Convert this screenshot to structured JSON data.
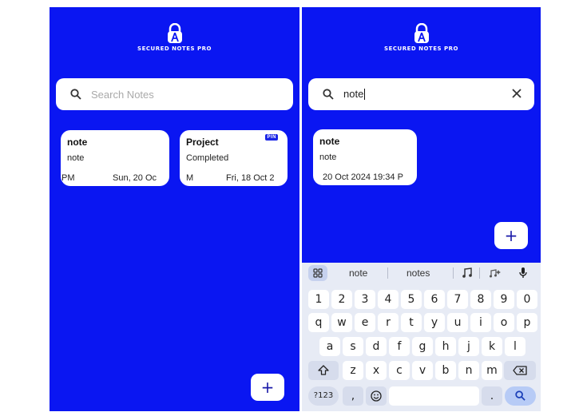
{
  "brand": {
    "app_name": "SECURED NOTES PRO",
    "bg_color": "#0a16f2"
  },
  "left_screen": {
    "search": {
      "placeholder": "Search Notes",
      "icon": "search-icon"
    },
    "notes": [
      {
        "title": "note",
        "body": "note",
        "footer_time": "PM",
        "footer_date": "Sun, 20 Oc"
      },
      {
        "title": "Project",
        "body": "Completed",
        "footer_time": "M",
        "footer_date": "Fri, 18 Oct 2",
        "pin_label": "PIN"
      }
    ],
    "fab_label": "+"
  },
  "right_screen": {
    "search": {
      "value": "note",
      "icon": "search-icon",
      "clear_icon": "close-icon"
    },
    "notes": [
      {
        "title": "note",
        "body": "note",
        "footer": "20 Oct 2024 19:34 P"
      }
    ],
    "fab_label": "+",
    "keyboard": {
      "suggestions": [
        "note",
        "notes"
      ],
      "icons": [
        "grid-icon",
        "music-note-icon",
        "audio-style-icon",
        "microphone-icon"
      ],
      "rows": [
        [
          "1",
          "2",
          "3",
          "4",
          "5",
          "6",
          "7",
          "8",
          "9",
          "0"
        ],
        [
          "q",
          "w",
          "e",
          "r",
          "t",
          "y",
          "u",
          "i",
          "o",
          "p"
        ],
        [
          "a",
          "s",
          "d",
          "f",
          "g",
          "h",
          "j",
          "k",
          "l"
        ],
        [
          "z",
          "x",
          "c",
          "v",
          "b",
          "n",
          "m"
        ]
      ],
      "shift_icon": "shift-icon",
      "backspace_icon": "backspace-icon",
      "symbols_label": "?123",
      "comma_label": ",",
      "emoji_icon": "emoji-icon",
      "period_label": ".",
      "enter_icon": "search-icon"
    }
  }
}
